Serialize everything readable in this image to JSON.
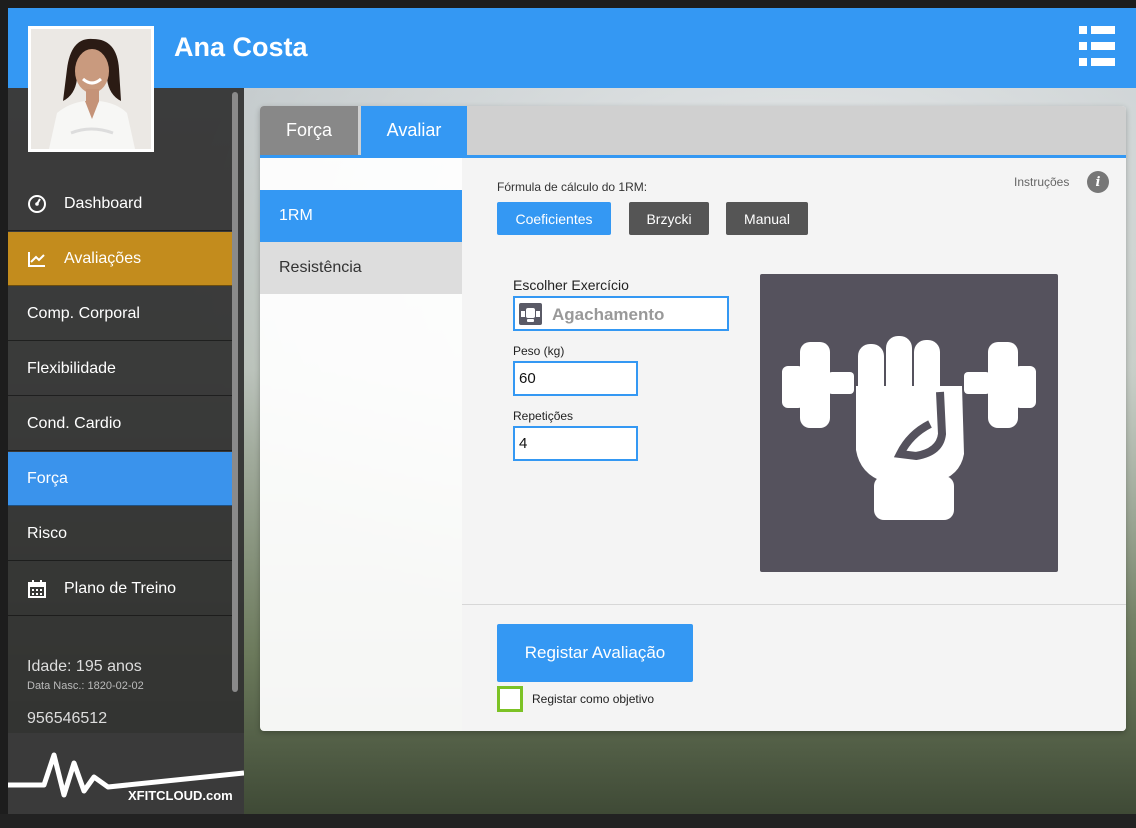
{
  "header": {
    "user_name": "Ana Costa"
  },
  "sidebar": {
    "items": [
      {
        "label": "Dashboard",
        "icon": "dashboard-gauge-icon"
      },
      {
        "label": "Avaliações",
        "icon": "chart-line-icon"
      },
      {
        "label": "Comp. Corporal"
      },
      {
        "label": "Flexibilidade"
      },
      {
        "label": "Cond. Cardio"
      },
      {
        "label": "Força"
      },
      {
        "label": "Risco"
      },
      {
        "label": "Plano de Treino",
        "icon": "calendar-icon"
      }
    ],
    "patient": {
      "age": "Idade: 195 anos",
      "birth": "Data Nasc.: 1820-02-02",
      "phone": "956546512"
    },
    "logo_text": "XFITCLOUD.com"
  },
  "tabs": {
    "forca": "Força",
    "avaliar": "Avaliar"
  },
  "subnav": {
    "rm": "1RM",
    "resistencia": "Resistência"
  },
  "form": {
    "formula_label": "Fórmula de cálculo do 1RM:",
    "formula_buttons": {
      "coef": "Coeficientes",
      "brzycki": "Brzycki",
      "manual": "Manual"
    },
    "instructions": "Instruções",
    "instructions_icon": "i",
    "exercise_label": "Escolher Exercício",
    "exercise_value": "Agachamento",
    "weight_label": "Peso (kg)",
    "weight_value": "60",
    "reps_label": "Repetições",
    "reps_value": "4",
    "submit": "Registar Avaliação",
    "objective_label": "Registar como objetivo"
  },
  "colors": {
    "primary": "#3498f3",
    "accent_orange": "#c38c1d",
    "checkbox_green": "#7cc225",
    "sidebar_bg": "#303030",
    "dark_button": "#555555"
  }
}
